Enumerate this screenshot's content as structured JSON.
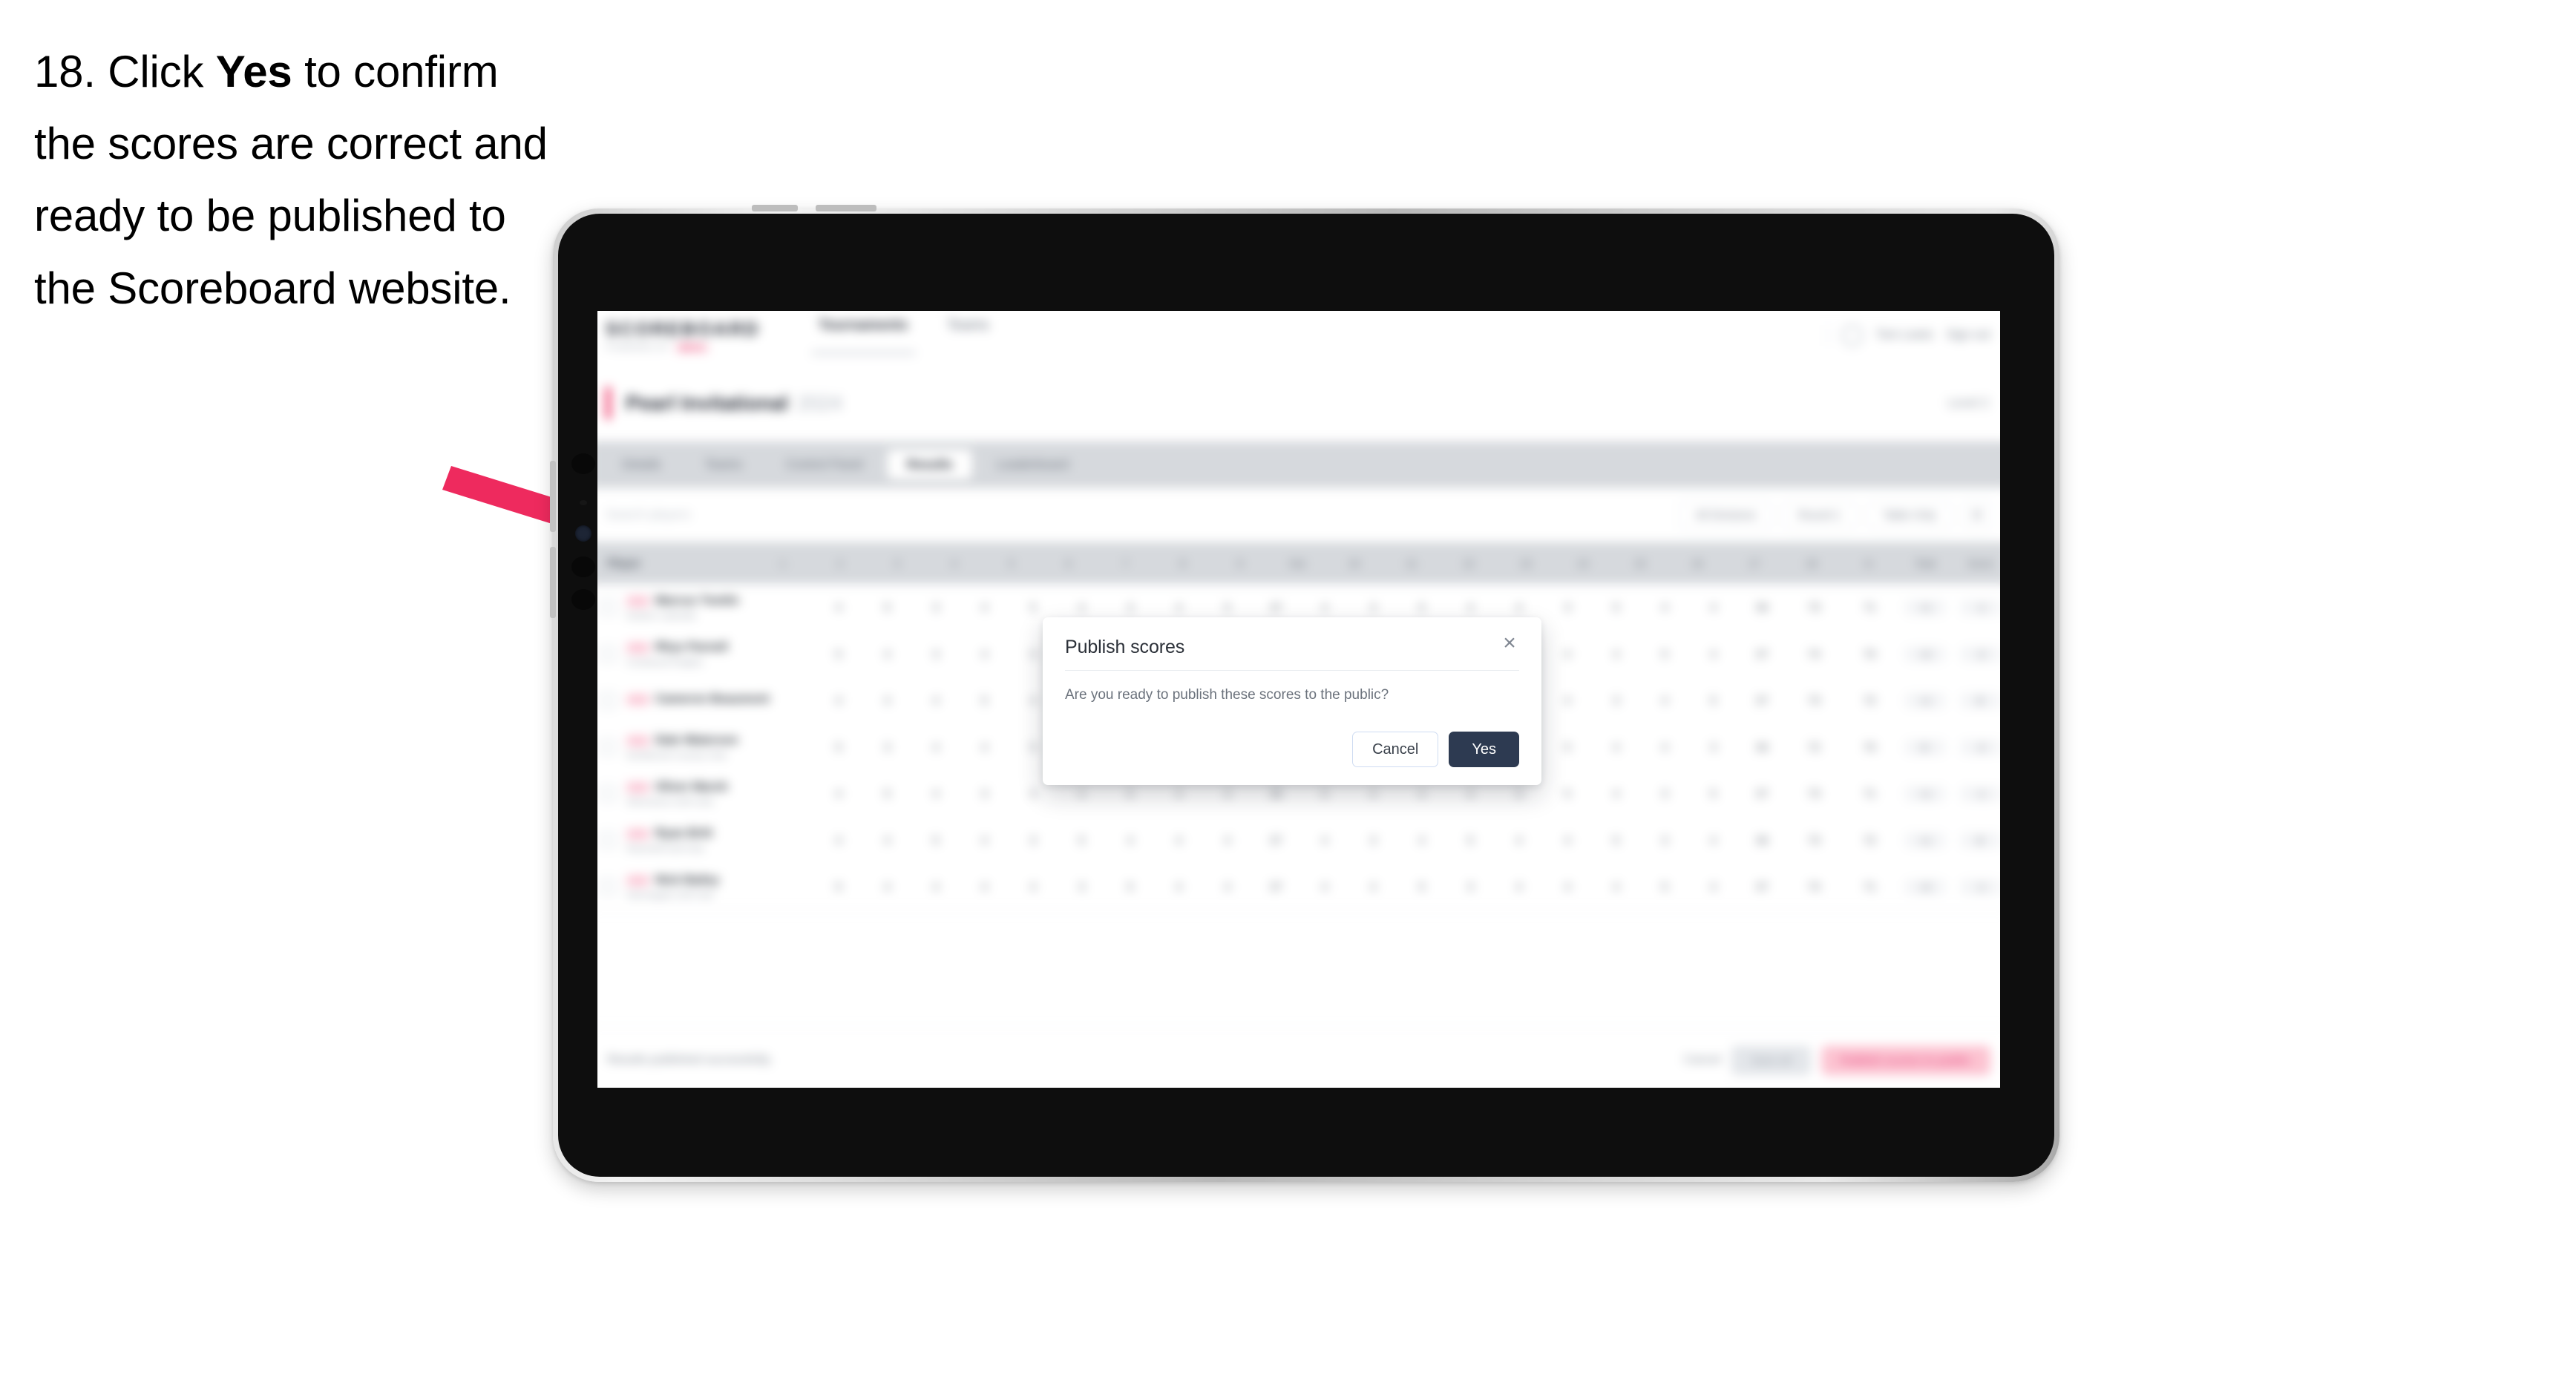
{
  "instruction": {
    "step_number": "18.",
    "text_before": "Click",
    "emphasis": "Yes",
    "text_after": "to confirm the scores are correct and ready to be published to the Scoreboard website."
  },
  "annotation": {
    "arrow_color": "#EE2A5E",
    "points_to": "yes-button"
  },
  "device": {
    "type": "tablet",
    "frame_color": "#0e0e0e",
    "rim_color": "#cfcfcf"
  },
  "app": {
    "logo": {
      "word": "SCOREBOARD",
      "sub": "POWERED BY",
      "chip": "BETA"
    },
    "topnav": [
      {
        "label": "Tournaments",
        "active": false
      },
      {
        "label": "Teams",
        "active": false
      }
    ],
    "topright": {
      "user": "Tom Lewis",
      "signout": "Sign out"
    },
    "event": {
      "title": "Pearl Invitational",
      "year": "2024",
      "meta": "Level 2"
    },
    "tabs": [
      {
        "label": "Details",
        "active": false
      },
      {
        "label": "Teams",
        "active": false
      },
      {
        "label": "Control Panel",
        "active": false
      },
      {
        "label": "Results",
        "active": true
      },
      {
        "label": "Leaderboard",
        "active": false
      }
    ],
    "search_placeholder": "Search players",
    "filters": [
      {
        "label": "All Divisions"
      },
      {
        "label": "Round 1"
      },
      {
        "label": "Table Only"
      },
      {
        "label": "☰"
      }
    ],
    "table": {
      "columns": [
        "Player",
        "1",
        "2",
        "3",
        "4",
        "5",
        "6",
        "7",
        "8",
        "9",
        "Out",
        "10",
        "11",
        "12",
        "13",
        "14",
        "15",
        "16",
        "17",
        "18",
        "In",
        "Total",
        "Score"
      ],
      "rows": [
        {
          "name": "Marcus Tomlin",
          "sub": "Eastern Lakeside",
          "holes": [
            "4",
            "5",
            "3",
            "4",
            "5",
            "4",
            "3",
            "4",
            "5",
            "37",
            "4",
            "3",
            "5",
            "4",
            "4",
            "3",
            "5",
            "4",
            "4",
            "36"
          ],
          "total": "73",
          "net": "71",
          "score1": "+1",
          "score2": "-1"
        },
        {
          "name": "Rhys Parnell",
          "sub": "Crestwood Heights",
          "holes": [
            "5",
            "4",
            "3",
            "4",
            "4",
            "5",
            "4",
            "3",
            "5",
            "37",
            "4",
            "4",
            "4",
            "5",
            "3",
            "4",
            "4",
            "5",
            "4",
            "37"
          ],
          "total": "74",
          "net": "70",
          "score1": "+2",
          "score2": "-2"
        },
        {
          "name": "Cameron Beaumont",
          "sub": "",
          "holes": [
            "4",
            "4",
            "4",
            "5",
            "4",
            "3",
            "4",
            "4",
            "4",
            "36",
            "5",
            "4",
            "3",
            "4",
            "5",
            "4",
            "3",
            "4",
            "5",
            "37"
          ],
          "total": "73",
          "net": "72",
          "score1": "+1",
          "score2": "E"
        },
        {
          "name": "Dale Waterson",
          "sub": "Northbrook Country Club",
          "holes": [
            "5",
            "3",
            "4",
            "4",
            "5",
            "4",
            "4",
            "3",
            "4",
            "36",
            "4",
            "5",
            "4",
            "3",
            "4",
            "5",
            "4",
            "4",
            "3",
            "36"
          ],
          "total": "72",
          "net": "70",
          "score1": "E",
          "score2": "-2"
        },
        {
          "name": "Oliver Marsh",
          "sub": "Silverstone Golf Links",
          "holes": [
            "4",
            "5",
            "4",
            "3",
            "4",
            "4",
            "5",
            "4",
            "3",
            "36",
            "5",
            "4",
            "4",
            "4",
            "3",
            "5",
            "4",
            "3",
            "5",
            "37"
          ],
          "total": "73",
          "net": "71",
          "score1": "+1",
          "score2": "-1"
        },
        {
          "name": "Ryan Britt",
          "sub": "Ravenhill Golf Club",
          "holes": [
            "4",
            "4",
            "5",
            "4",
            "3",
            "5",
            "4",
            "4",
            "4",
            "37",
            "4",
            "3",
            "4",
            "5",
            "4",
            "4",
            "5",
            "3",
            "4",
            "36"
          ],
          "total": "73",
          "net": "72",
          "score1": "+1",
          "score2": "E"
        },
        {
          "name": "Nick Bailey",
          "sub": "Harrowgate Golf Club",
          "holes": [
            "5",
            "4",
            "4",
            "4",
            "4",
            "3",
            "5",
            "4",
            "4",
            "37",
            "4",
            "4",
            "5",
            "3",
            "4",
            "4",
            "4",
            "5",
            "4",
            "37"
          ],
          "total": "74",
          "net": "71",
          "score1": "+2",
          "score2": "-1"
        }
      ]
    },
    "footer": {
      "note": "Results published successfully.",
      "link": "Cancel",
      "secondary_button": "Save all",
      "primary_button": "Publish scores to public"
    }
  },
  "modal": {
    "title": "Publish scores",
    "close_icon": "×",
    "body": "Are you ready to publish these scores to the public?",
    "cancel_label": "Cancel",
    "confirm_label": "Yes",
    "confirm_bg": "#2d3a51",
    "cancel_border": "#cfdcf2"
  }
}
